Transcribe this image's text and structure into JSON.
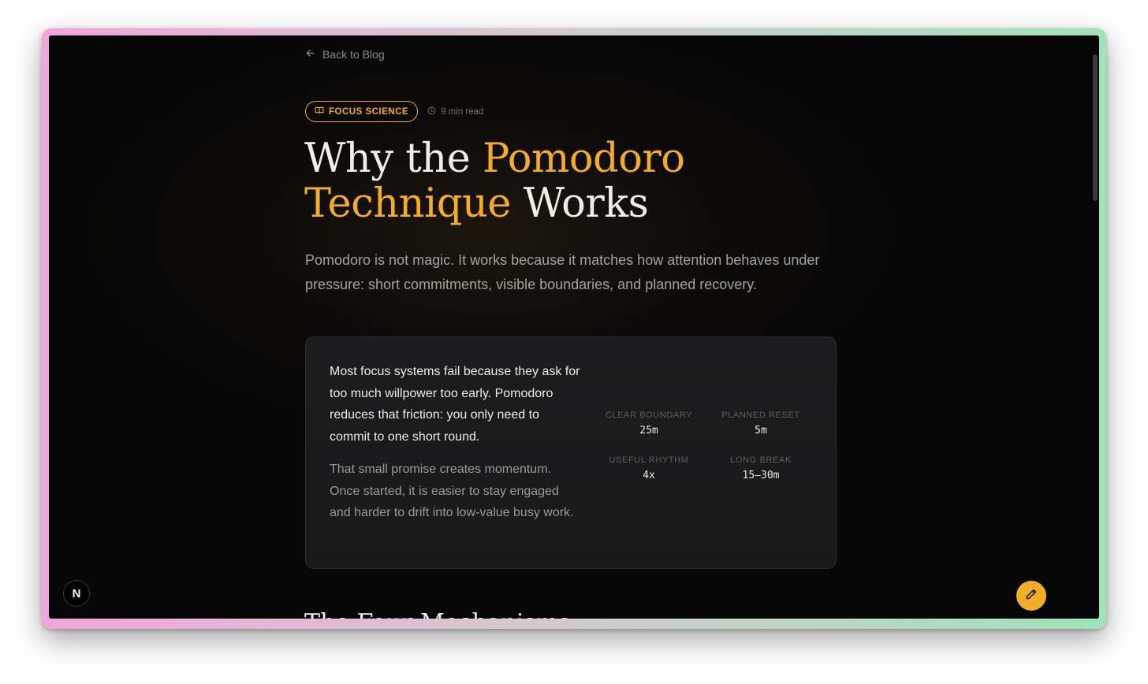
{
  "nav": {
    "back_label": "Back to Blog"
  },
  "meta": {
    "tag": "FOCUS SCIENCE",
    "read_time": "9 min read"
  },
  "title": {
    "part1": "Why the ",
    "accent1": "Pomodoro",
    "accent2": "Technique",
    "part2": " Works"
  },
  "lede": "Pomodoro is not magic. It works because it matches how attention behaves under pressure: short commitments, visible boundaries, and planned recovery.",
  "card": {
    "paragraph1": "Most focus systems fail because they ask for too much willpower too early. Pomodoro reduces that friction: you only need to commit to one short round.",
    "paragraph2": "That small promise creates momentum. Once started, it is easier to stay engaged and harder to drift into low-value busy work.",
    "stats": [
      {
        "label": "CLEAR BOUNDARY",
        "value": "25m"
      },
      {
        "label": "PLANNED RESET",
        "value": "5m"
      },
      {
        "label": "USEFUL RHYTHM",
        "value": "4x"
      },
      {
        "label": "LONG BREAK",
        "value": "15–30m"
      }
    ]
  },
  "next_section_heading": "The Four Mechanisms",
  "badge": {
    "letter": "N"
  },
  "colors": {
    "accent": "#f3ad26",
    "background": "#070707",
    "card": "#1c1c1e"
  },
  "icons": {
    "back": "arrow-left-icon",
    "tag": "book-open-icon",
    "clock": "clock-icon",
    "fab": "pencil-icon"
  }
}
